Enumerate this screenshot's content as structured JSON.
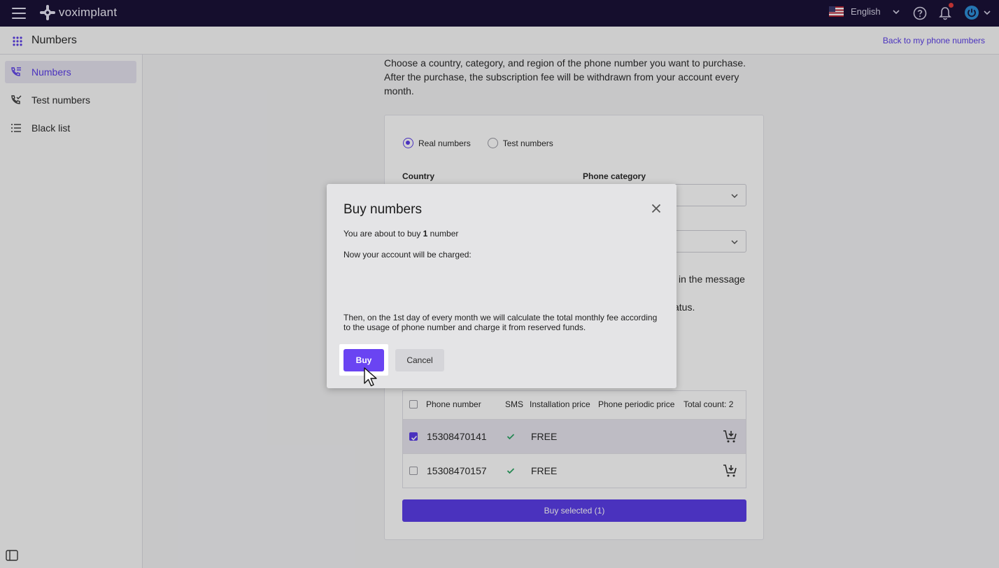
{
  "topbar": {
    "brand": "voximplant",
    "language": "English",
    "icons": [
      "menu-icon",
      "help-icon",
      "bell-icon",
      "power-icon"
    ]
  },
  "subbar": {
    "title": "Numbers",
    "back_link": "Back to my phone numbers"
  },
  "sidebar": {
    "items": [
      {
        "label": "Numbers",
        "icon": "phone-list-icon",
        "active": true
      },
      {
        "label": "Test numbers",
        "icon": "phone-check-icon",
        "active": false
      },
      {
        "label": "Black list",
        "icon": "list-icon",
        "active": false
      }
    ]
  },
  "main": {
    "intro_line1": "Choose a country, category, and region of the phone number you want to purchase.",
    "intro_line2": "After the purchase, the subscription fee will be withdrawn from your account every month.",
    "radio_real": "Real numbers",
    "radio_test": "Test numbers",
    "country_label": "Country",
    "category_label": "Phone category",
    "fragment_message": "in the message",
    "fragment_status": "atus.",
    "table": {
      "headers": [
        "Phone number",
        "SMS",
        "Installation price",
        "Phone periodic price",
        "Total count: 2"
      ],
      "rows": [
        {
          "number": "15308470141",
          "installation": "FREE",
          "selected": true
        },
        {
          "number": "15308470157",
          "installation": "FREE",
          "selected": false
        }
      ]
    },
    "buy_selected": "Buy selected (1)"
  },
  "modal": {
    "title": "Buy numbers",
    "line1_prefix": "You are about to buy ",
    "line1_count": "1",
    "line1_suffix": " number",
    "line2": "Now your account will be charged:",
    "line3": "Then, on the 1st day of every month we will calculate the total monthly fee according to the usage of phone number and charge it from reserved funds.",
    "buy_label": "Buy",
    "cancel_label": "Cancel"
  },
  "colors": {
    "topbar": "#1a1238",
    "accent": "#5b3ee8",
    "modal_bg": "#e4e4e6"
  }
}
